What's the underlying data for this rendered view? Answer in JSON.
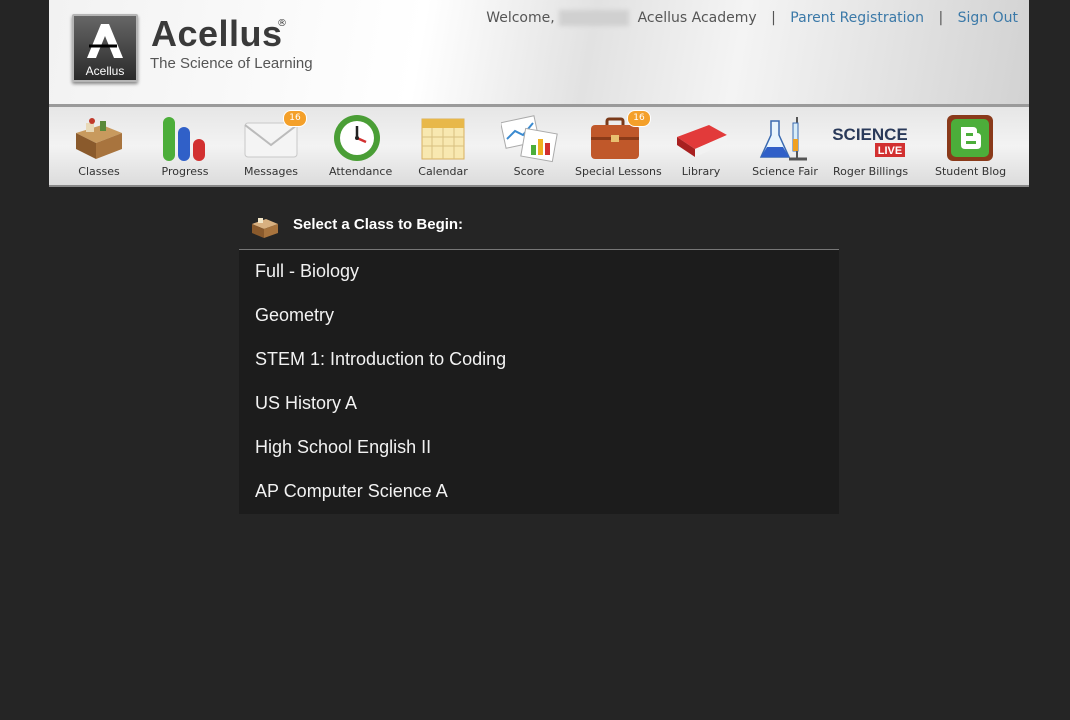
{
  "brand": {
    "name": "Acellus",
    "registered": "®",
    "tagline": "The Science of Learning",
    "logo_text": "Acellus"
  },
  "topnav": {
    "welcome": "Welcome,",
    "academy": "Acellus Academy",
    "separator": "|",
    "parent_registration": "Parent Registration",
    "sign_out": "Sign Out"
  },
  "toolbar": {
    "items": [
      {
        "label": "Classes",
        "icon": "classes-desk-icon"
      },
      {
        "label": "Progress",
        "icon": "progress-bars-icon"
      },
      {
        "label": "Messages",
        "icon": "envelope-icon",
        "badge": "16"
      },
      {
        "label": "Attendance",
        "icon": "clock-icon"
      },
      {
        "label": "Calendar",
        "icon": "calendar-icon"
      },
      {
        "label": "Score",
        "icon": "score-chart-icon"
      },
      {
        "label": "Special Lessons",
        "icon": "briefcase-icon",
        "badge": "16"
      },
      {
        "label": "Library",
        "icon": "book-icon"
      },
      {
        "label": "Science Fair",
        "icon": "flask-icon"
      },
      {
        "label": "Roger Billings",
        "icon": "science-live-icon",
        "logo_text": "SCIENCE",
        "logo_sub": "LIVE"
      },
      {
        "label": "Student Blog",
        "icon": "blogger-icon"
      }
    ]
  },
  "classes": {
    "title": "Select a Class to Begin:",
    "items": [
      "Full - Biology",
      "Geometry",
      "STEM 1: Introduction to Coding",
      "US History A",
      "High School English II",
      "AP Computer Science A"
    ]
  },
  "colors": {
    "link": "#3b79a8",
    "background": "#252525",
    "badge": "#f4a02a"
  }
}
